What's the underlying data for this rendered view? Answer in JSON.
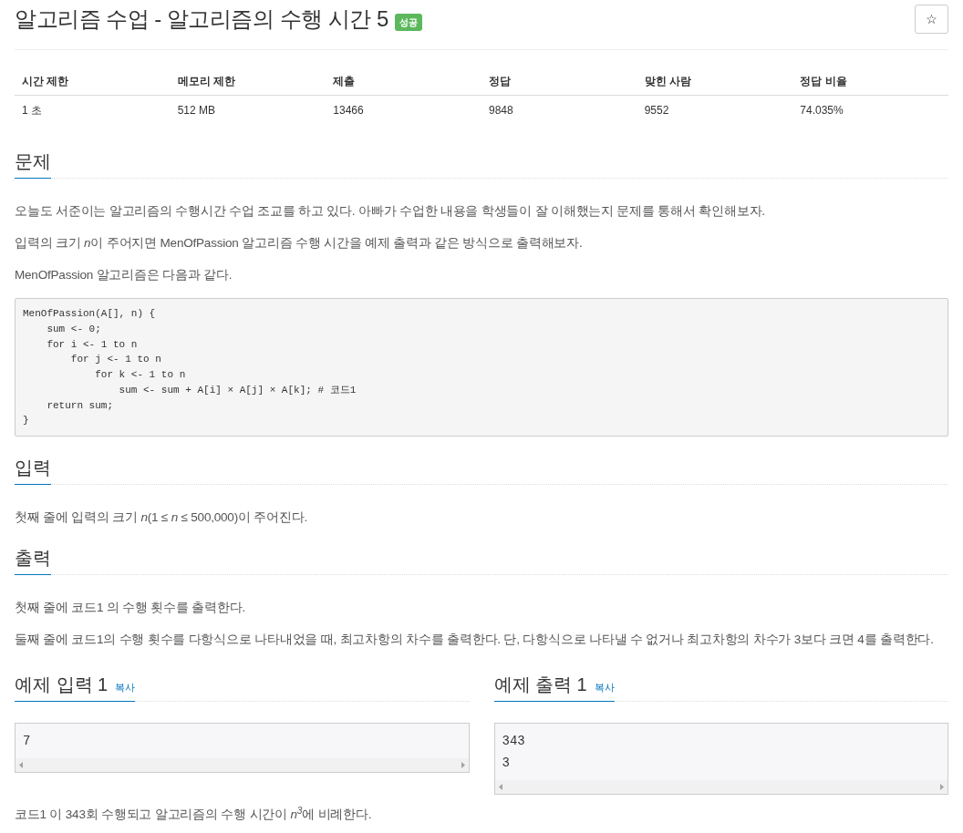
{
  "title": "알고리즘 수업 - 알고리즘의 수행 시간 5",
  "status_badge": "성공",
  "star_button": "☆",
  "stats_table": {
    "columns": [
      "시간 제한",
      "메모리 제한",
      "제출",
      "정답",
      "맞힌 사람",
      "정답 비율"
    ],
    "rows": [
      [
        "1 초",
        "512 MB",
        "13466",
        "9848",
        "9552",
        "74.035%"
      ]
    ]
  },
  "sections": [
    {
      "heading": "문제",
      "paragraphs": [
        "오늘도 서준이는 알고리즘의 수행시간 수업 조교를 하고 있다. 아빠가 수업한 내용을 학생들이 잘 이해했는지 문제를 통해서 확인해보자.",
        {
          "runs": [
            {
              "text": "입력의 크기 ",
              "italic": false
            },
            {
              "text": "n",
              "italic": true
            },
            {
              "text": "이 주어지면 MenOfPassion 알고리즘 수행 시간을 예제 출력과 같은 방식으로 출력해보자.",
              "italic": false
            }
          ]
        },
        "MenOfPassion 알고리즘은 다음과 같다."
      ],
      "code": "MenOfPassion(A[], n) {\n    sum <- 0;\n    for i <- 1 to n\n        for j <- 1 to n\n            for k <- 1 to n\n                sum <- sum + A[i] × A[j] × A[k]; # 코드1\n    return sum;\n}"
    },
    {
      "heading": "입력",
      "paragraphs": [
        "첫째 줄에 입력의 크기 *n*(1 ≤ *n* ≤ 500,000)이 주어진다."
      ]
    },
    {
      "heading": "출력",
      "paragraphs": [
        "첫째 줄에 코드1 의 수행 횟수를 출력한다.",
        "둘째 줄에 코드1의 수행 횟수를 다항식으로 나타내었을 때, 최고차항의 차수를 출력한다. 단, 다항식으로 나타낼 수 없거나 최고차항의 차수가 3보다 크면 4를 출력한다."
      ]
    }
  ],
  "samples": [
    {
      "heading": "예제 입력 1",
      "copy_link": "복사",
      "content": "7"
    },
    {
      "heading": "예제 출력 1",
      "copy_link": "복사",
      "content": "343\n3"
    }
  ],
  "sample_explanation": "코드1 이 343회 수행되고 알고리즘의 수행 시간이 *n*$^{3}$에 비례한다."
}
